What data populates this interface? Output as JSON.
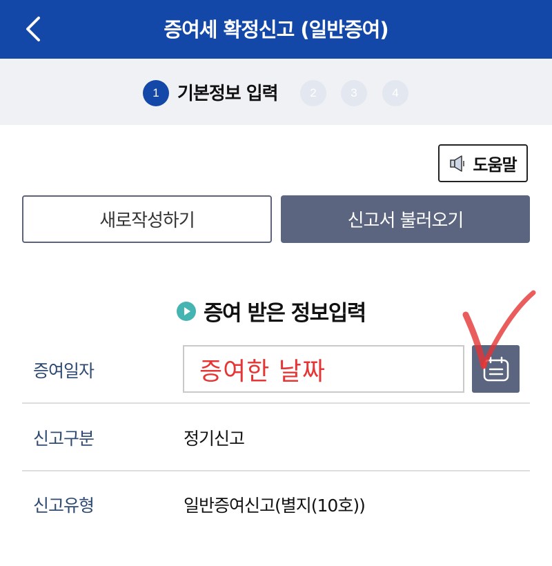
{
  "header": {
    "title": "증여세 확정신고 (일반증여)"
  },
  "steps": [
    {
      "number": "1",
      "label": "기본정보 입력"
    },
    {
      "number": "2"
    },
    {
      "number": "3"
    },
    {
      "number": "4"
    }
  ],
  "help_button": {
    "label": "도움말"
  },
  "actions": {
    "new_label": "새로작성하기",
    "load_label": "신고서 불러오기"
  },
  "section": {
    "title": "증여 받은 정보입력"
  },
  "form": {
    "gift_date": {
      "label": "증여일자",
      "value": "증여한 날짜"
    },
    "report_category": {
      "label": "신고구분",
      "value": "정기신고"
    },
    "report_type": {
      "label": "신고유형",
      "value": "일반증여신고(별지(10호))"
    }
  },
  "colors": {
    "primary": "#1448a8",
    "button_dark": "#5b6580",
    "label_blue": "#2e4a72",
    "annotation_red": "#e53535",
    "section_icon": "#46b5b1"
  }
}
